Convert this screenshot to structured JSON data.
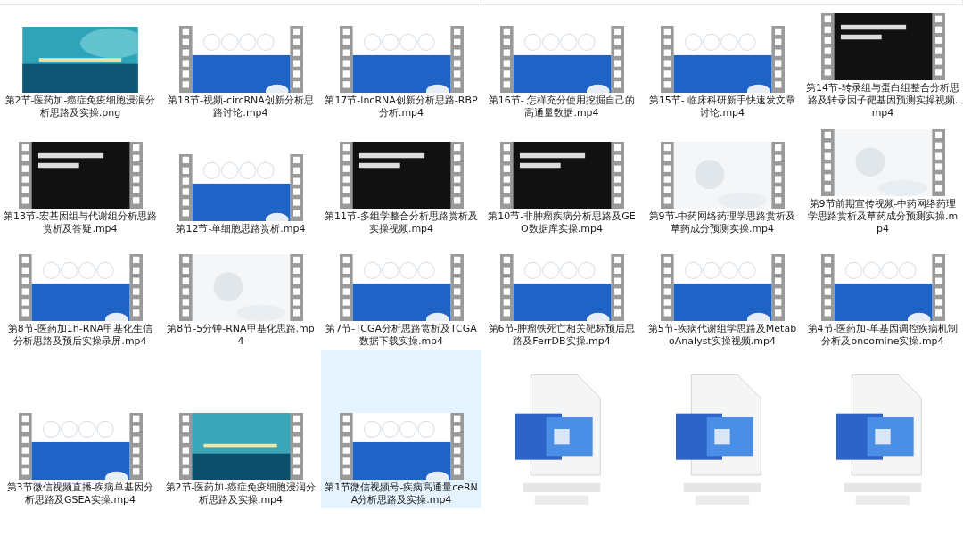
{
  "files": [
    {
      "name": "第2节-医药加-癌症免疫细胞浸润分析思路及实操.png",
      "selected": false
    },
    {
      "name": "第18节-视频-circRNA创新分析思路讨论.mp4",
      "kind": "video-blue",
      "selected": false
    },
    {
      "name": "第17节-lncRNA创新分析思路-RBP分析.mp4",
      "kind": "video-blue",
      "selected": false
    },
    {
      "name": "第16节- 怎样充分使用挖掘自己的高通量数据.mp4",
      "kind": "video-blue",
      "selected": false
    },
    {
      "name": "第15节- 临床科研新手快速发文章讨论.mp4",
      "kind": "video-blue",
      "selected": false
    },
    {
      "name": "第14节-转录组与蛋白组整合分析思路及转录因子靶基因预测实操视频.mp4",
      "kind": "video-dark",
      "selected": false
    },
    {
      "name": "第13节-宏基因组与代谢组分析思路赏析及答疑.mp4",
      "kind": "video-dark",
      "selected": false
    },
    {
      "name": "第12节-单细胞思路赏析.mp4",
      "kind": "video-blue",
      "selected": false
    },
    {
      "name": "第11节-多组学整合分析思路赏析及实操视频.mp4",
      "kind": "video-dark",
      "selected": false
    },
    {
      "name": "第10节-非肿瘤疾病分析思路及GEO数据库实操.mp4",
      "kind": "video-dark",
      "selected": false
    },
    {
      "name": "第9节-中药网络药理学思路赏析及草药成分预测实操.mp4",
      "kind": "video-white",
      "selected": false
    },
    {
      "name": "第9节前期宣传视频-中药网络药理学思路赏析及草药成分预测实操.mp4",
      "kind": "video-white",
      "selected": false
    },
    {
      "name": "第8节-医药加1h-RNA甲基化生信分析思路及预后实操录屏.mp4",
      "kind": "video-blue",
      "selected": false
    },
    {
      "name": "第8节-5分钟-RNA甲基化思路.mp4",
      "kind": "video-white",
      "selected": false
    },
    {
      "name": "第7节-TCGA分析思路赏析及TCGA数据下载实操.mp4",
      "kind": "video-blue",
      "selected": false
    },
    {
      "name": "第6节-肿瘤铁死亡相关靶标预后思路及FerrDB实操.mp4",
      "kind": "video-blue",
      "selected": false
    },
    {
      "name": "第5节-疾病代谢组学思路及MetaboAnalyst实操视频.mp4",
      "kind": "video-blue",
      "selected": false
    },
    {
      "name": "第4节-医药加-单基因调控疾病机制分析及oncomine实操.mp4",
      "kind": "video-blue",
      "selected": false
    },
    {
      "name": "第3节微信视频直播-疾病单基因分析思路及GSEA实操.mp4",
      "kind": "video-blue",
      "selected": false
    },
    {
      "name": "第2节-医药加-癌症免疫细胞浸润分析思路及实操.mp4",
      "kind": "video-teal",
      "selected": false
    },
    {
      "name": "第1节微信视频号-疾病高通量ceRNA分析思路及实操.mp4",
      "kind": "video-blue",
      "selected": true
    },
    {
      "kind": "file",
      "selected": false
    },
    {
      "kind": "file",
      "selected": false
    },
    {
      "kind": "file",
      "selected": false
    }
  ]
}
